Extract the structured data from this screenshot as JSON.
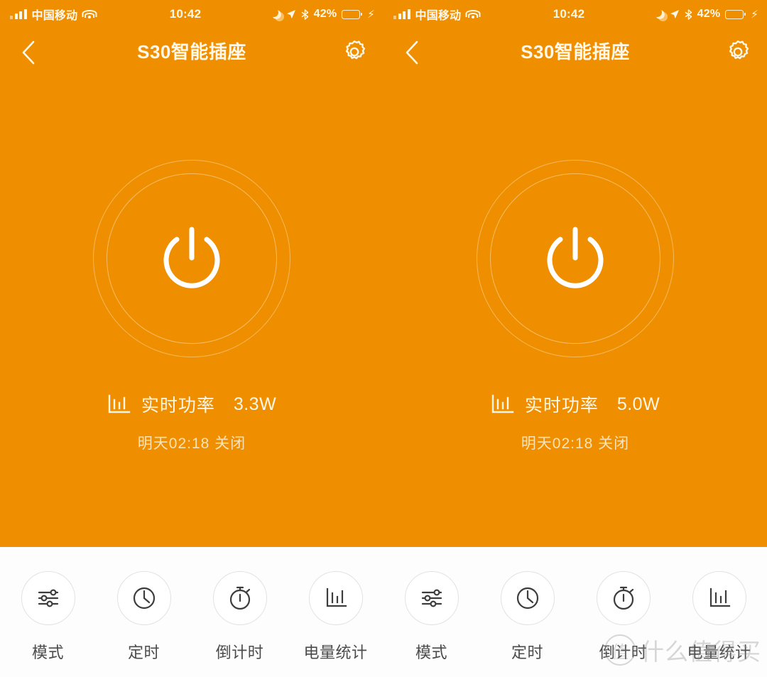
{
  "theme": {
    "orange": "#ef8f00",
    "cream": "#fff8ea",
    "battery_green": "#4cd35f",
    "toolbar_bg": "#fdfdfd",
    "icon_gray": "#4b4b4b"
  },
  "screens": [
    {
      "status_bar": {
        "signal_icon": "signal-bars-icon",
        "carrier": "中国移动",
        "wifi_icon": "wifi-icon",
        "time": "10:42",
        "moon_icon": "do-not-disturb-moon-icon",
        "location_icon": "location-arrow-icon",
        "bluetooth_icon": "bluetooth-icon",
        "battery_percent": "42%",
        "battery_level": 42,
        "battery_icon": "battery-icon",
        "charging_icon": "lightning-bolt-icon"
      },
      "nav": {
        "back_icon": "chevron-left-icon",
        "title": "S30智能插座",
        "settings_icon": "gear-icon"
      },
      "power": {
        "icon": "power-icon",
        "state": "on"
      },
      "realtime": {
        "icon": "bar-chart-icon",
        "label": "实时功率",
        "value": "3.3W"
      },
      "schedule": "明天02:18  关闭",
      "toolbar": [
        {
          "icon": "sliders-icon",
          "label": "模式"
        },
        {
          "icon": "clock-icon",
          "label": "定时"
        },
        {
          "icon": "stopwatch-icon",
          "label": "倒计时"
        },
        {
          "icon": "bar-chart-icon",
          "label": "电量统计"
        }
      ]
    },
    {
      "status_bar": {
        "signal_icon": "signal-bars-icon",
        "carrier": "中国移动",
        "wifi_icon": "wifi-icon",
        "time": "10:42",
        "moon_icon": "do-not-disturb-moon-icon",
        "location_icon": "location-arrow-icon",
        "bluetooth_icon": "bluetooth-icon",
        "battery_percent": "42%",
        "battery_level": 42,
        "battery_icon": "battery-icon",
        "charging_icon": "lightning-bolt-icon"
      },
      "nav": {
        "back_icon": "chevron-left-icon",
        "title": "S30智能插座",
        "settings_icon": "gear-icon"
      },
      "power": {
        "icon": "power-icon",
        "state": "on"
      },
      "realtime": {
        "icon": "bar-chart-icon",
        "label": "实时功率",
        "value": "5.0W"
      },
      "schedule": "明天02:18  关闭",
      "toolbar": [
        {
          "icon": "sliders-icon",
          "label": "模式"
        },
        {
          "icon": "clock-icon",
          "label": "定时"
        },
        {
          "icon": "stopwatch-icon",
          "label": "倒计时"
        },
        {
          "icon": "bar-chart-icon",
          "label": "电量统计"
        }
      ]
    }
  ],
  "watermark": {
    "logo_text": "值",
    "text": "什么值得买"
  }
}
